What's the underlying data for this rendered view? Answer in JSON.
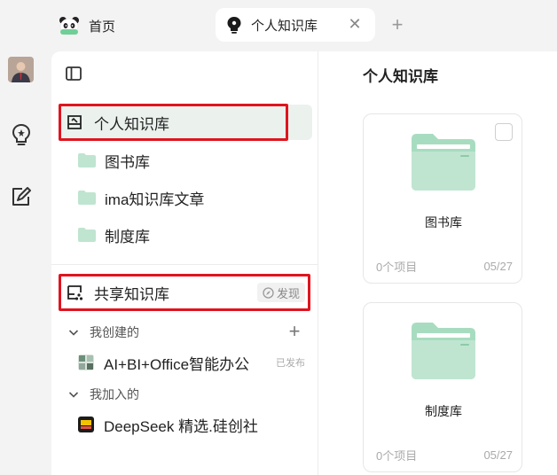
{
  "tabs": [
    {
      "label": "首页",
      "icon": "panda-icon"
    },
    {
      "label": "个人知识库",
      "icon": "bulb-icon",
      "active": true
    }
  ],
  "sidebar": {
    "personal": {
      "label": "个人知识库"
    },
    "folders": [
      {
        "label": "图书库"
      },
      {
        "label": "ima知识库文章"
      },
      {
        "label": "制度库"
      }
    ],
    "shared": {
      "label": "共享知识库",
      "discover": "发现"
    },
    "created_group": {
      "label": "我创建的"
    },
    "created_items": [
      {
        "label": "AI+BI+Office智能办公",
        "badge": "已发布"
      }
    ],
    "joined_group": {
      "label": "我加入的"
    },
    "joined_items": [
      {
        "label": "DeepSeek 精选.硅创社"
      }
    ]
  },
  "main": {
    "title": "个人知识库",
    "cards": [
      {
        "name": "图书库",
        "count": "0个项目",
        "date": "05/27"
      },
      {
        "name": "制度库",
        "count": "0个项目",
        "date": "05/27"
      }
    ]
  },
  "colors": {
    "accent_green": "#a8dcc0",
    "active_bg": "#ebf2ee",
    "highlight_red": "#e0141f"
  }
}
